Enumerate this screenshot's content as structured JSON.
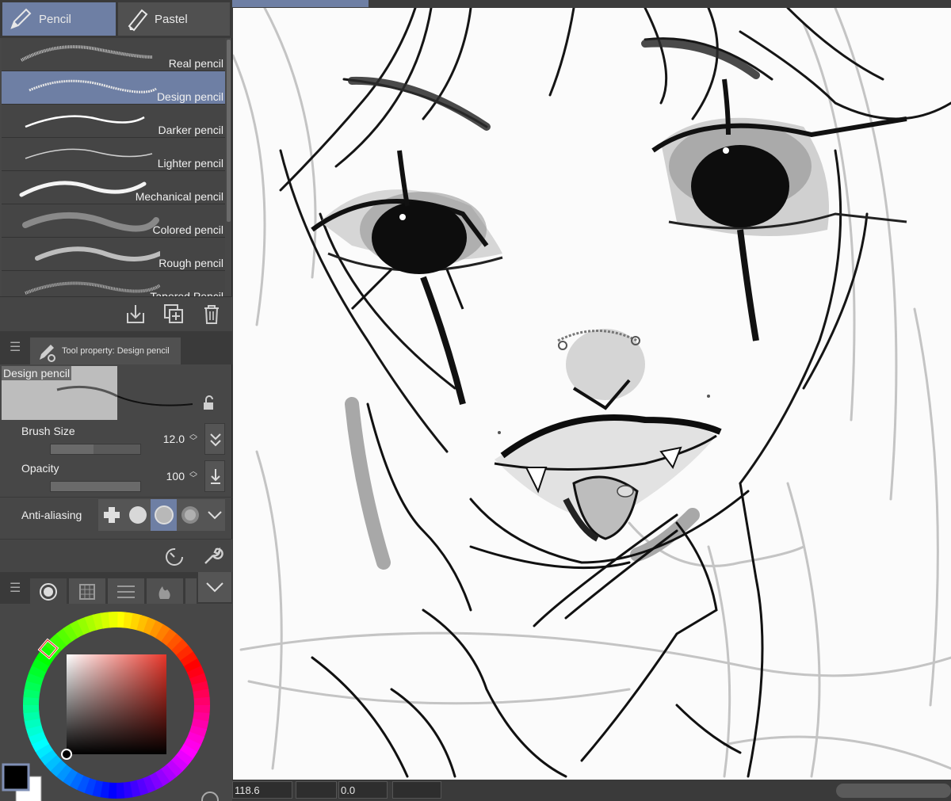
{
  "brush_tabs": [
    {
      "label": "Pencil",
      "active": true,
      "icon": "pencil-icon"
    },
    {
      "label": "Pastel",
      "active": false,
      "icon": "pastel-icon"
    }
  ],
  "brushes": [
    {
      "label": "Real pencil",
      "selected": false
    },
    {
      "label": "Design pencil",
      "selected": true
    },
    {
      "label": "Darker pencil",
      "selected": false
    },
    {
      "label": "Lighter pencil",
      "selected": false
    },
    {
      "label": "Mechanical pencil",
      "selected": false
    },
    {
      "label": "Colored pencil",
      "selected": false
    },
    {
      "label": "Rough pencil",
      "selected": false
    },
    {
      "label": "Tapered Pencil",
      "selected": false
    }
  ],
  "brush_actions": [
    "import-icon",
    "duplicate-icon",
    "trash-icon"
  ],
  "tool_property": {
    "tab_label": "Tool property: Design pencil",
    "preview_label": "Design pencil",
    "brush_size": {
      "label": "Brush Size",
      "value": "12.0"
    },
    "opacity": {
      "label": "Opacity",
      "value": "100"
    },
    "anti_aliasing": {
      "label": "Anti-aliasing",
      "selected_index": 2
    }
  },
  "color": {
    "main": "#000000",
    "sub": "#ffffff",
    "hue_marker": "#e8362a"
  },
  "status": {
    "zoom": "118.6",
    "rotation": "0.0"
  },
  "accent": "#6e7fa4"
}
